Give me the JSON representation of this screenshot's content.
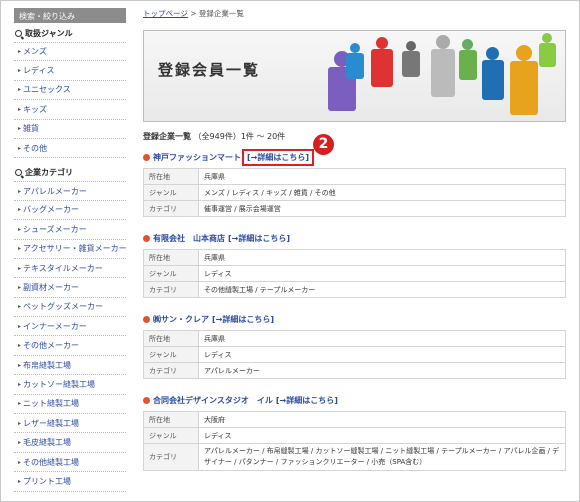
{
  "sidebar": {
    "heading": "検索・絞り込み",
    "genre_title": "取扱ジャンル",
    "genres": [
      "メンズ",
      "レディス",
      "ユニセックス",
      "キッズ",
      "雑貨",
      "その他"
    ],
    "category_title": "企業カテゴリ",
    "categories": [
      "アパレルメーカー",
      "バッグメーカー",
      "シューズメーカー",
      "アクセサリー・雑貨メーカー",
      "テキスタイルメーカー",
      "副資材メーカー",
      "ペットグッズメーカー",
      "インナーメーカー",
      "その他メーカー",
      "布帛縫製工場",
      "カットソー縫製工場",
      "ニット縫製工場",
      "レザー縫製工場",
      "毛皮縫製工場",
      "その他縫製工場",
      "プリント工場"
    ]
  },
  "breadcrumb": {
    "home": "トップページ",
    "sep": " > ",
    "current": "登録企業一覧"
  },
  "banner": {
    "title": "登録会員一覧"
  },
  "count": {
    "label": "登録企業一覧",
    "detail": "（全949件）1件 ～ 20件"
  },
  "annotation": {
    "number": "2"
  },
  "companies": [
    {
      "name": "神戸ファッションマート",
      "detail_link": "[→詳細はこちら]",
      "rows": [
        {
          "label": "所在地",
          "value": "兵庫県"
        },
        {
          "label": "ジャンル",
          "value": "メンズ / レディス / キッズ / 雑貨 / その他"
        },
        {
          "label": "カテゴリ",
          "value": "催事運営 / 展示会場運営"
        }
      ]
    },
    {
      "name": "有限会社　山本商店",
      "detail_link": "[→詳細はこちら]",
      "rows": [
        {
          "label": "所在地",
          "value": "兵庫県"
        },
        {
          "label": "ジャンル",
          "value": "レディス"
        },
        {
          "label": "カテゴリ",
          "value": "その他縫製工場 / テープルメーカー"
        }
      ]
    },
    {
      "name": "㈱サン・クレア",
      "detail_link": "[→詳細はこちら]",
      "rows": [
        {
          "label": "所在地",
          "value": "兵庫県"
        },
        {
          "label": "ジャンル",
          "value": "レディス"
        },
        {
          "label": "カテゴリ",
          "value": "アパレルメーカー"
        }
      ]
    },
    {
      "name": "合同会社デザインスタジオ　イル",
      "detail_link": "[→詳細はこちら]",
      "rows": [
        {
          "label": "所在地",
          "value": "大阪府"
        },
        {
          "label": "ジャンル",
          "value": "レディス"
        },
        {
          "label": "カテゴリ",
          "value": "アパレルメーカー / 布帛縫製工場 / カットソー縫製工場 / ニット縫製工場 / テープルメーカー / アパレル企画 / デザイナー / パタンナー / ファッションクリエーター / 小売（SPA含む）"
        }
      ]
    }
  ]
}
